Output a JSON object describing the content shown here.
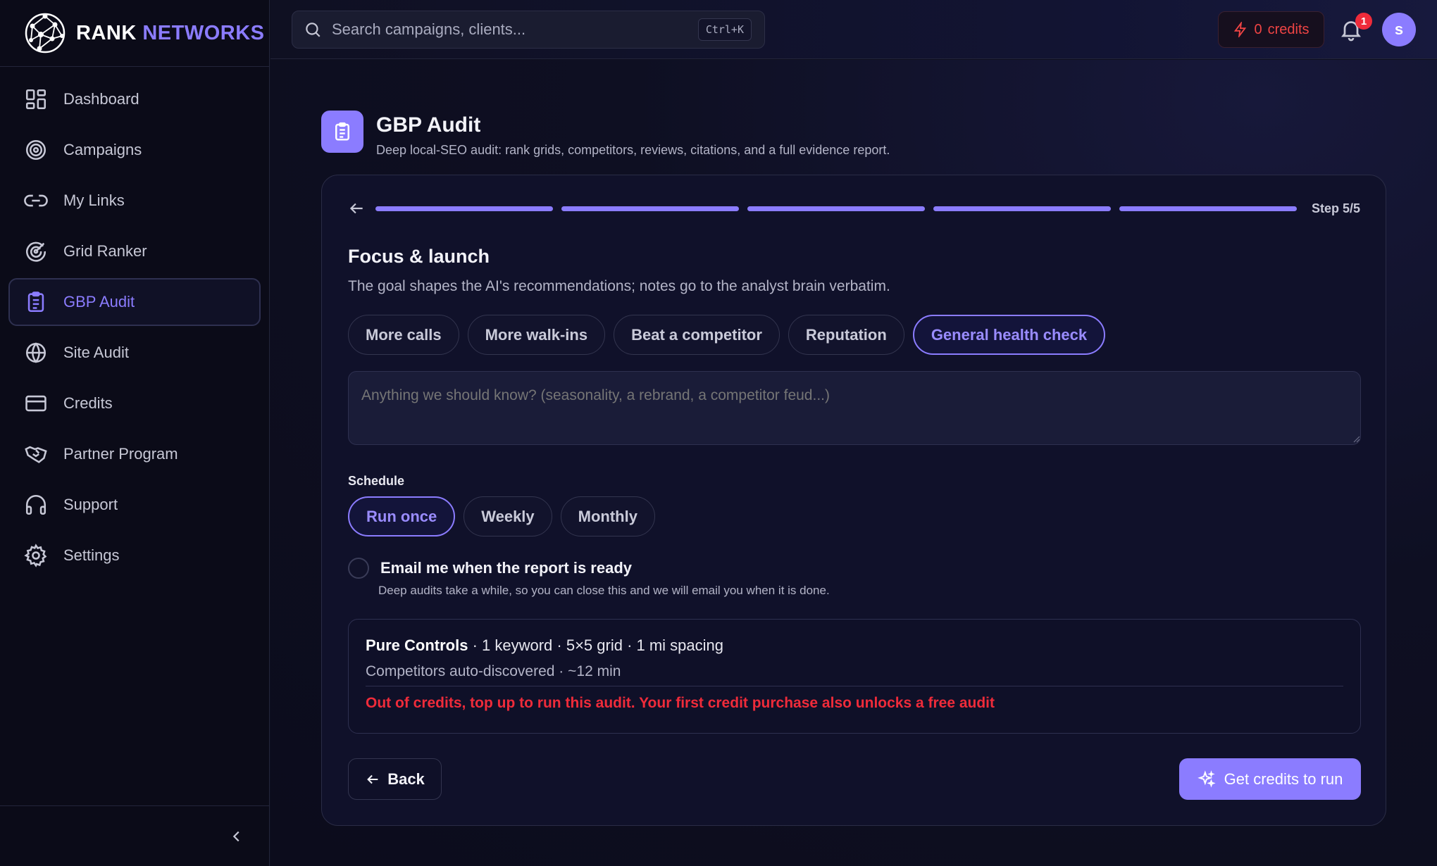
{
  "brand": {
    "word1": "RANK",
    "word2": "NETWORKS"
  },
  "sidebar": {
    "items": [
      {
        "label": "Dashboard",
        "icon": "dashboard-icon"
      },
      {
        "label": "Campaigns",
        "icon": "target-icon"
      },
      {
        "label": "My Links",
        "icon": "link-icon"
      },
      {
        "label": "Grid Ranker",
        "icon": "radar-icon"
      },
      {
        "label": "GBP Audit",
        "icon": "clipboard-icon",
        "active": true
      },
      {
        "label": "Site Audit",
        "icon": "globe-icon"
      },
      {
        "label": "Credits",
        "icon": "credit-card-icon"
      },
      {
        "label": "Partner Program",
        "icon": "handshake-icon"
      },
      {
        "label": "Support",
        "icon": "headphones-icon"
      },
      {
        "label": "Settings",
        "icon": "gear-icon"
      }
    ]
  },
  "topbar": {
    "search_placeholder": "Search campaigns, clients...",
    "shortcut": "Ctrl+K",
    "credits_count": "0",
    "credits_label": "credits",
    "notifications": "1",
    "avatar_initial": "s"
  },
  "page": {
    "title": "GBP Audit",
    "subtitle": "Deep local-SEO audit: rank grids, competitors, reviews, citations, and a full evidence report."
  },
  "wizard": {
    "step": "Step 5/5",
    "progress": 1.0,
    "heading": "Focus & launch",
    "description": "The goal shapes the AI's recommendations; notes go to the analyst brain verbatim.",
    "goals": [
      "More calls",
      "More walk-ins",
      "Beat a competitor",
      "Reputation",
      "General health check"
    ],
    "selected_goal": "General health check",
    "notes_placeholder": "Anything we should know? (seasonality, a rebrand, a competitor feud...)",
    "schedule_label": "Schedule",
    "schedule_options": [
      "Run once",
      "Weekly",
      "Monthly"
    ],
    "selected_schedule": "Run once",
    "email_label": "Email me when the report is ready",
    "email_sub": "Deep audits take a while, so you can close this and we will email you when it is done.",
    "summary": {
      "client": "Pure Controls",
      "details": " · 1 keyword · 5×5 grid · 1 mi spacing",
      "line2": "Competitors auto-discovered · ~12 min",
      "warning": "Out of credits, top up to run this audit. Your first credit purchase also unlocks a free audit"
    },
    "back_label": "Back",
    "cta_label": "Get credits to run"
  },
  "colors": {
    "accent": "#8b7cff",
    "danger": "#ef2b3a",
    "background": "#0d0e1f"
  }
}
